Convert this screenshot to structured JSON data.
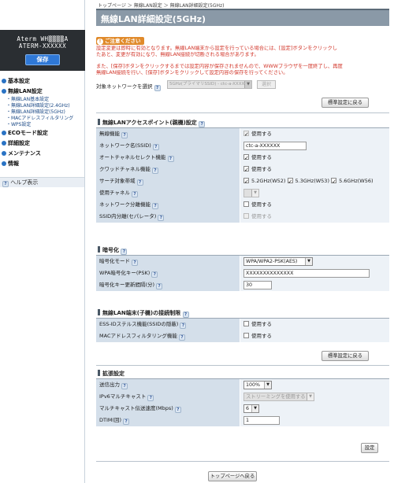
{
  "sidebar": {
    "model": "Aterm WH▒▒▒▒A",
    "device_id": "ATERM-XXXXXX",
    "save_label": "保存",
    "nav": [
      {
        "label": "基本設定"
      },
      {
        "label": "無線LAN設定"
      },
      {
        "label": "・無線LAN基本設定",
        "sub": true
      },
      {
        "label": "・無線LAN詳細設定(2.4GHz)",
        "sub": true
      },
      {
        "label": "・無線LAN詳細設定(5GHz)",
        "sub": true
      },
      {
        "label": "・MACアドレスフィルタリング",
        "sub": true
      },
      {
        "label": "・WPS設定",
        "sub": true
      },
      {
        "label": "ECOモード設定"
      },
      {
        "label": "詳細設定"
      },
      {
        "label": "メンテナンス"
      },
      {
        "label": "情報"
      }
    ],
    "help_label": "ヘルプ表示"
  },
  "header": {
    "breadcrumb": "トップページ ＞ 無線LAN設定 ＞ 無線LAN詳細設定(5GHz)",
    "title": "無線LAN詳細設定(5GHz)"
  },
  "notice": {
    "label": "ご注意ください",
    "lines": [
      "設定変更は即時に有効となります。無線LAN端末から設定を行っている場合には、[設定]ボタンをクリックし",
      "たあと、変更が有効になり、無線LAN接続が切断される場合があります。",
      "また、[保存]ボタンをクリックするまでは設定内容が保存されませんので、WWWブラウザを一度終了し、再度",
      "無線LAN接続を行い、[保存]ボタンをクリックして設定内容の保存を行ってください。"
    ]
  },
  "target_network": {
    "label": "対象ネットワークを選択",
    "value": "5GHz(プライマリSSID) - ctc-a-XXXXXX",
    "button": "選択"
  },
  "buttons": {
    "reset_top": "標準設定に戻る",
    "reset_mid": "標準設定に戻る",
    "apply": "設定",
    "back_top": "トップページへ戻る"
  },
  "sections": {
    "ap": {
      "title": "無線LANアクセスポイント(親機)設定",
      "rows": {
        "enable": {
          "label": "無線機能",
          "value": "使用する"
        },
        "ssid": {
          "label": "ネットワーク名(SSID)",
          "value": "ctc-a-XXXXXX"
        },
        "auto_channel": {
          "label": "オートチャネルセレクト機能",
          "value": "使用する"
        },
        "quad": {
          "label": "クワッドチャネル機能",
          "value": "使用する"
        },
        "band": {
          "label": "サーチ対象帯域",
          "w52": "5.2GHz(W52)",
          "w53": "5.3GHz(W53)",
          "w56": "5.6GHz(W56)"
        },
        "channel": {
          "label": "使用チャネル"
        },
        "separator": {
          "label": "ネットワーク分離機能",
          "value": "使用する"
        },
        "ssid_sep": {
          "label": "SSID内分離(セパレータ)",
          "value": "使用する"
        }
      }
    },
    "enc": {
      "title": "暗号化",
      "rows": {
        "mode": {
          "label": "暗号化モード",
          "value": "WPA/WPA2-PSK(AES)"
        },
        "psk": {
          "label": "WPA暗号化キー(PSK)",
          "value": "XXXXXXXXXXXXXX"
        },
        "interval": {
          "label": "暗号化キー更新間隔(分)",
          "value": "30"
        }
      }
    },
    "limit": {
      "title": "無線LAN端末(子機)の接続制限",
      "rows": {
        "stealth": {
          "label": "ESS-IDステルス機能(SSIDの隠蔽)",
          "value": "使用する"
        },
        "mac": {
          "label": "MACアドレスフィルタリング機能",
          "value": "使用する"
        }
      }
    },
    "ext": {
      "title": "拡張設定",
      "rows": {
        "power": {
          "label": "送信出力",
          "value": "100%"
        },
        "ipv6": {
          "label": "IPv6マルチキャスト",
          "value": "ストリーミングを使用する"
        },
        "mcast": {
          "label": "マルチキャスト伝送速度(Mbps)",
          "value": "6"
        },
        "dtim": {
          "label": "DTIM(回)",
          "value": "1"
        }
      }
    }
  }
}
